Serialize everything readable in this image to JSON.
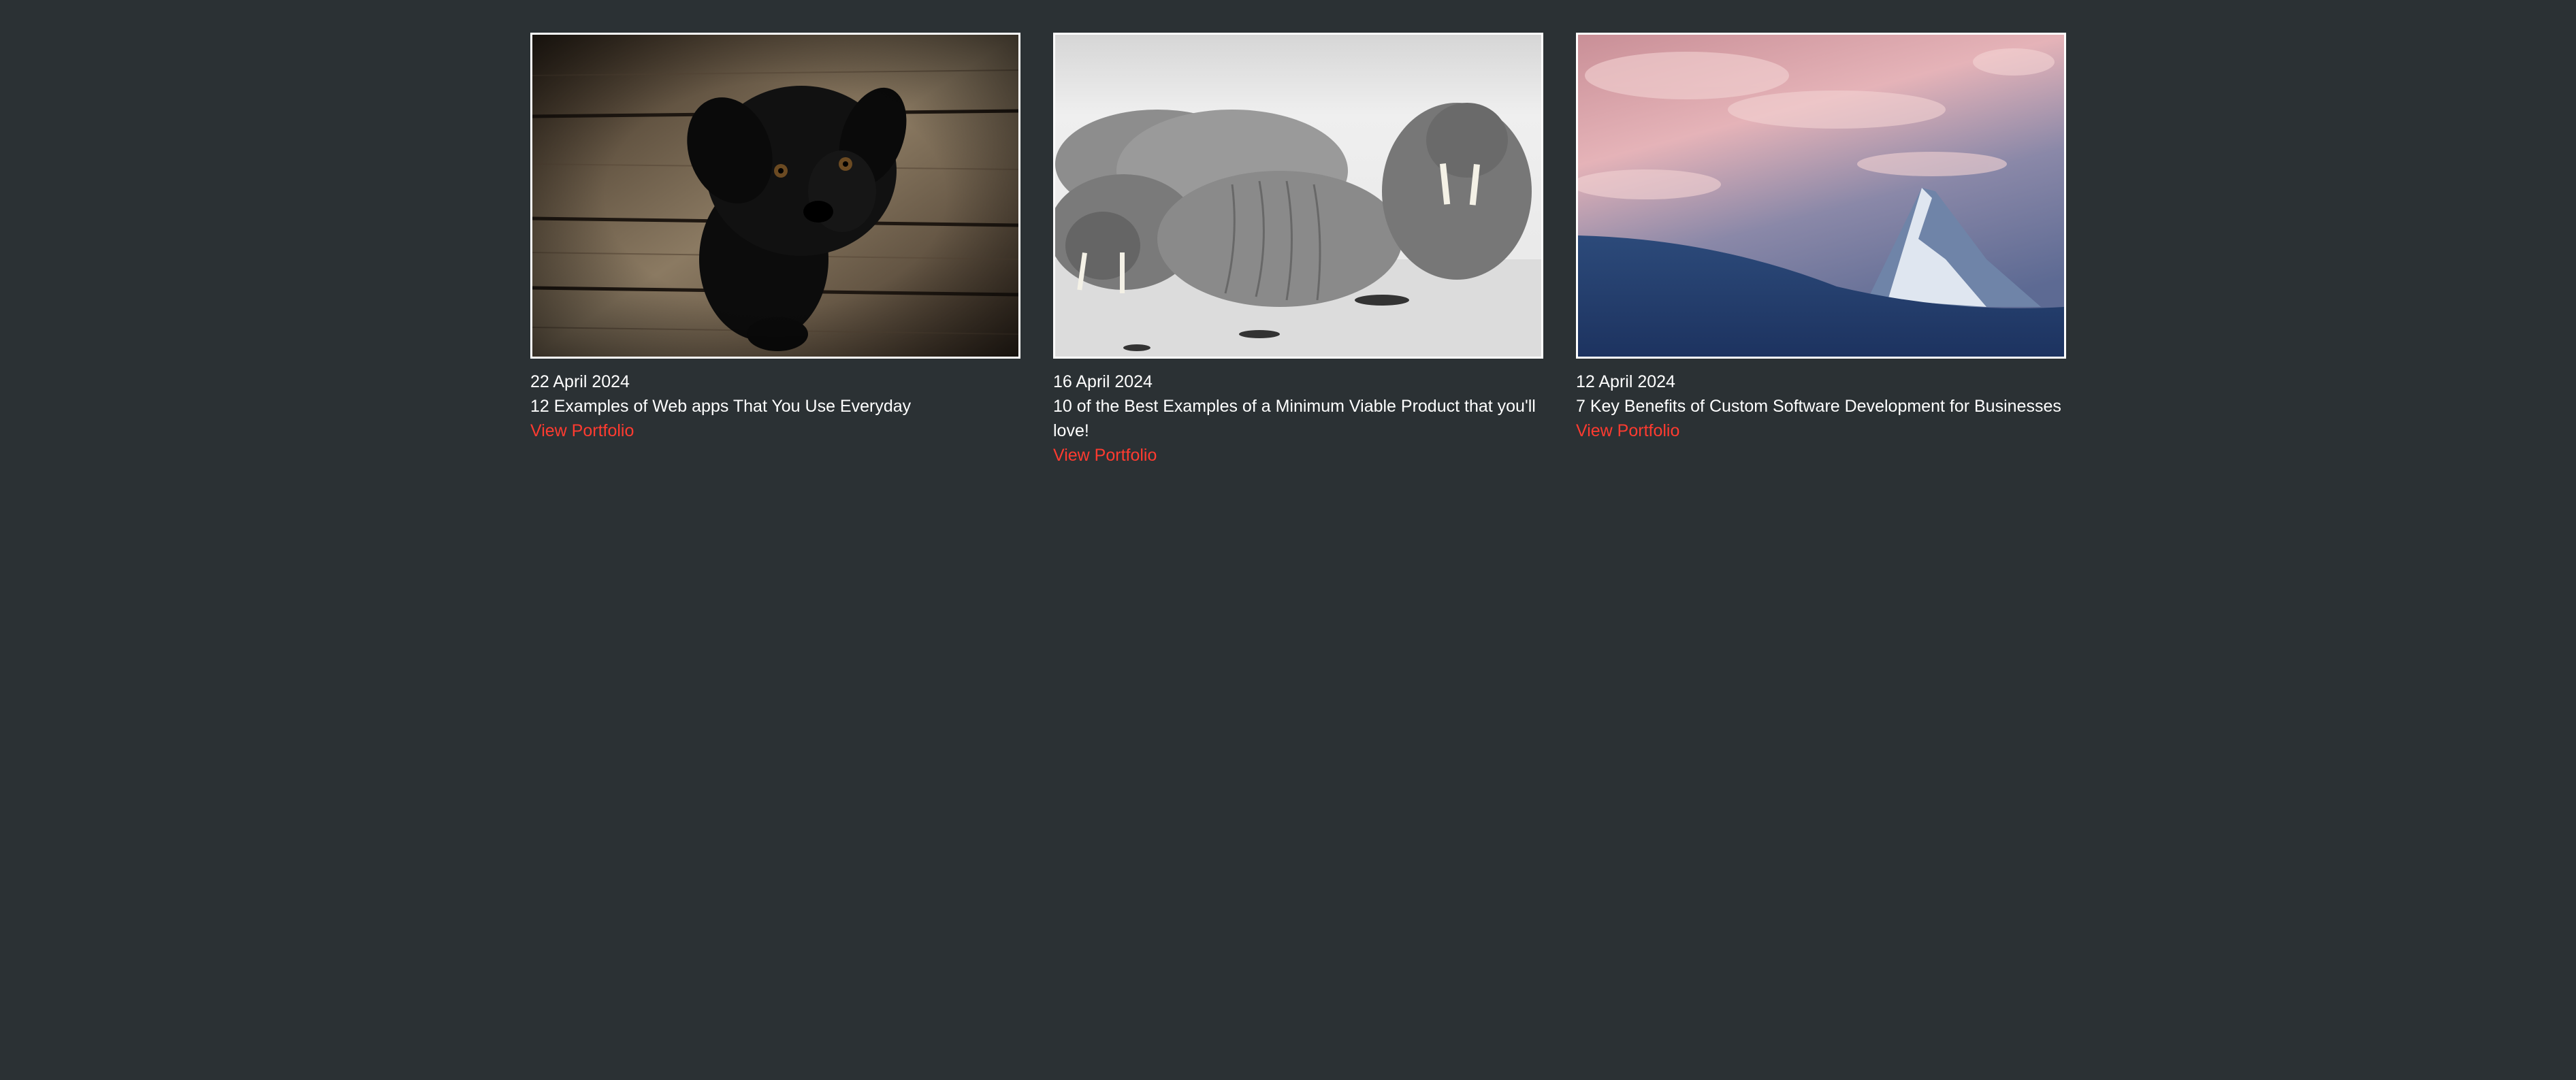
{
  "theme": {
    "background": "#2b3134",
    "text": "#ffffff",
    "link": "#ff3b30"
  },
  "portfolio": {
    "items": [
      {
        "date": "22 April 2024",
        "title": "12 Examples of Web apps That You Use Everyday",
        "link_label": "View Portfolio",
        "image_subject": "black puppy on wooden planks"
      },
      {
        "date": "16 April 2024",
        "title": "10 of the Best Examples of a Minimum Viable Product that you'll love!",
        "link_label": "View Portfolio",
        "image_subject": "walruses resting on sand (black and white)"
      },
      {
        "date": "12 April 2024",
        "title": "7 Key Benefits of Custom Software Development for Businesses",
        "link_label": "View Portfolio",
        "image_subject": "snowy mountain peak at dusk"
      }
    ]
  }
}
